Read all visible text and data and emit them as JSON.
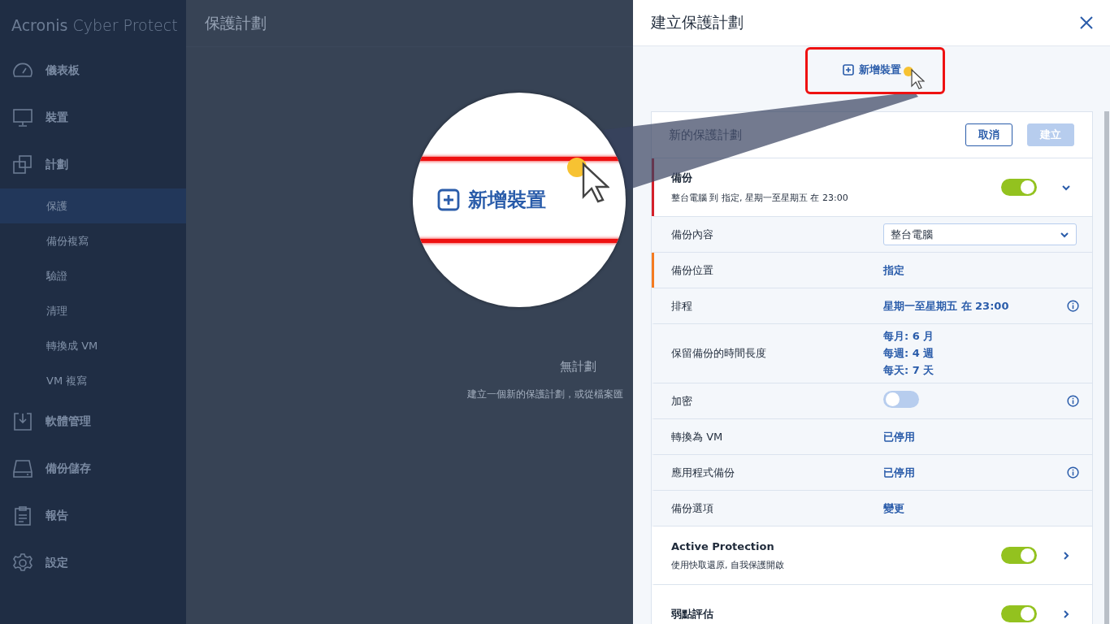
{
  "sidebar": {
    "logo_brand": "Acronis",
    "logo_product": "Cyber Protect",
    "items": [
      {
        "label": "儀表板",
        "selected": false
      },
      {
        "label": "裝置",
        "selected": false
      },
      {
        "label": "計劃",
        "selected": false,
        "children": [
          {
            "label": "保護",
            "selected": true
          },
          {
            "label": "備份複寫",
            "selected": false
          },
          {
            "label": "驗證",
            "selected": false
          },
          {
            "label": "清理",
            "selected": false
          },
          {
            "label": "轉換成 VM",
            "selected": false
          },
          {
            "label": "VM 複寫",
            "selected": false
          }
        ]
      },
      {
        "label": "軟體管理",
        "selected": false
      },
      {
        "label": "備份儲存",
        "selected": false
      },
      {
        "label": "報告",
        "selected": false
      },
      {
        "label": "設定",
        "selected": false
      }
    ]
  },
  "main": {
    "title": "保護計劃",
    "empty_title": "無計劃",
    "empty_text": "建立一個新的保護計劃，或從檔案匯"
  },
  "magnifier": {
    "label": "新增裝置"
  },
  "panel": {
    "title": "建立保護計劃",
    "add_device": "新增裝置",
    "highlighted": true,
    "card": {
      "title": "新的保護計劃",
      "buttons": [
        {
          "label": "取消",
          "disabled": false
        },
        {
          "label": "建立",
          "disabled": true
        }
      ],
      "sections": [
        {
          "kind": "module",
          "title": "備份",
          "subtitle": "整台電腦 到 指定, 星期一至星期五 在 23:00",
          "on": true,
          "expanded": true,
          "color": "#d4202a"
        },
        {
          "kind": "select",
          "label": "備份內容",
          "value": "整台電腦"
        },
        {
          "kind": "link",
          "label": "備份位置",
          "values": [
            "指定"
          ],
          "color": "#f47b20",
          "info": false
        },
        {
          "kind": "link",
          "label": "排程",
          "values": [
            "星期一至星期五 在 23:00"
          ],
          "info": true
        },
        {
          "kind": "link",
          "label": "保留備份的時間長度",
          "values": [
            "每月: 6 月",
            "每週: 4 週",
            "每天: 7 天"
          ],
          "info": false
        },
        {
          "kind": "toggle",
          "label": "加密",
          "on": false,
          "info": true
        },
        {
          "kind": "link",
          "label": "轉換為 VM",
          "values": [
            "已停用"
          ],
          "info": false
        },
        {
          "kind": "link",
          "label": "應用程式備份",
          "values": [
            "已停用"
          ],
          "info": true
        },
        {
          "kind": "link",
          "label": "備份選項",
          "values": [
            "變更"
          ],
          "info": false
        },
        {
          "kind": "module",
          "title": "Active Protection",
          "subtitle": "使用快取還原, 自我保護開啟",
          "on": true,
          "expanded": false
        },
        {
          "kind": "module",
          "title": "弱點評估",
          "on": true,
          "expanded": false
        }
      ]
    }
  }
}
